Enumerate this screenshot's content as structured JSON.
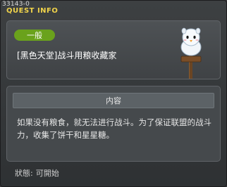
{
  "window": {
    "id_tag": "33143-0",
    "title": "QUEST INFO"
  },
  "quest": {
    "category": "一般",
    "name": "[黑色天堂]战斗用粮收藏家"
  },
  "content": {
    "header": "内容",
    "body": "如果没有粮食，就无法进行战斗。为了保证联盟的战斗力，收集了饼干和星星糖。"
  },
  "status": {
    "label": "狀態:",
    "value": "可開始"
  },
  "icons": {
    "npc": "snowman-on-signpost-icon"
  },
  "colors": {
    "title": "#f0d34a",
    "badge": "#6aa21c"
  }
}
